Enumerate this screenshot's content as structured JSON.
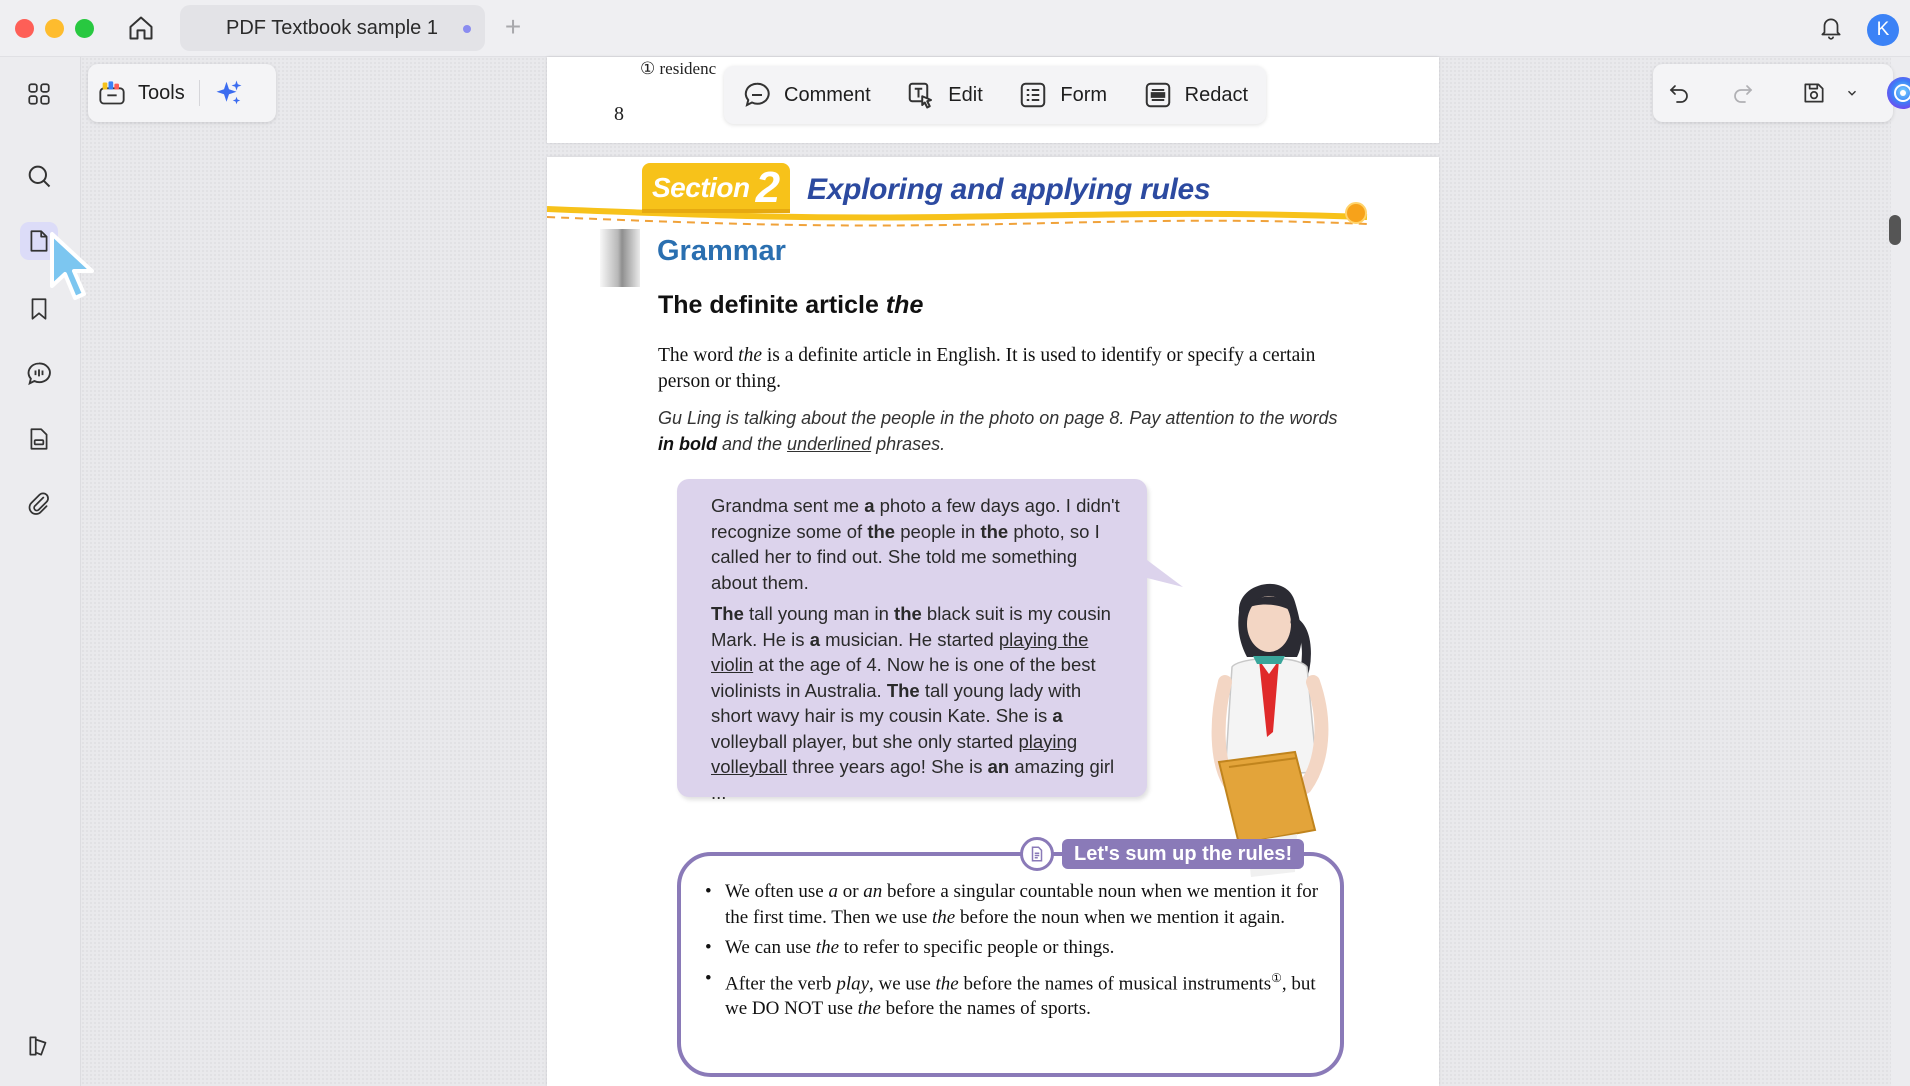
{
  "titlebar": {
    "tab_label": "PDF Textbook sample 1",
    "new_tab": "+",
    "avatar_letter": "K"
  },
  "toolbar": {
    "tools_label": "Tools",
    "comment_label": "Comment",
    "edit_label": "Edit",
    "form_label": "Form",
    "redact_label": "Redact"
  },
  "sidebar": {
    "items": [
      "grid-icon",
      "search-icon",
      "page-icon",
      "bookmark-icon",
      "comment-icon",
      "form-icon",
      "attachment-icon",
      "sidebar-icon"
    ],
    "active_item": "page-icon"
  },
  "page_prev": {
    "footnote_fragment": "① residenc",
    "page_number": "8"
  },
  "page": {
    "section_word": "Section",
    "section_number": "2",
    "section_title": "Exploring and applying rules",
    "grammar_label": "Grammar",
    "heading_prefix": "The definite article ",
    "heading_italic": "the",
    "intro_1": "The word ",
    "intro_italic": "the",
    "intro_2": " is a definite article in English. It is used to identify or specify a certain person or thing.",
    "instruction_1": "Gu Ling is talking about the people in the photo on page 8. Pay attention to the words ",
    "instruction_bold": "in bold",
    "instruction_2": " and the ",
    "instruction_underline": "underlined",
    "instruction_3": " phrases.",
    "bubble": {
      "p1": [
        "Grandma sent me ",
        "a",
        " photo a few days ago. I didn't recognize some of ",
        "the",
        " people in ",
        "the",
        " photo, so I called her to find out. She told me something about them."
      ],
      "p2": [
        "The",
        " tall young man in ",
        "the",
        " black suit is my cousin Mark. He is ",
        "a",
        " musician. He started ",
        "playing the violin",
        " at the age of 4. Now he is one of the best violinists in Australia. ",
        "The",
        " tall young lady with short wavy hair is my cousin Kate. She is ",
        "a",
        " volleyball player, but she only started ",
        "playing",
        " ",
        "volleyball",
        " three years ago! She is ",
        "an",
        " amazing girl ..."
      ]
    },
    "rules_tag": "Let's sum up the rules!",
    "rules": [
      {
        "a": "We often use ",
        "i1": "a",
        "b": " or ",
        "i2": "an",
        "c": " before a singular countable noun when we mention it for the first time. Then we use ",
        "i3": "the",
        "d": " before the noun when we mention it again."
      },
      {
        "a": "We can use ",
        "i1": "the",
        "b": " to refer to specific people or things."
      },
      {
        "a": "After the verb ",
        "i1": "play",
        "b": ", we use ",
        "i2": "the",
        "c": " before the names of musical instruments",
        "sup": "①",
        "d": ", but we DO NOT use ",
        "i3": "the",
        "e": " before the names of sports."
      }
    ]
  },
  "colors": {
    "accent": "#8a8cf0",
    "section_yellow": "#f7c21a",
    "section_title": "#2c4aa0",
    "grammar": "#2a6fb0",
    "bubble_bg": "#dcd3ec",
    "rules_border": "#8a7ab8"
  }
}
